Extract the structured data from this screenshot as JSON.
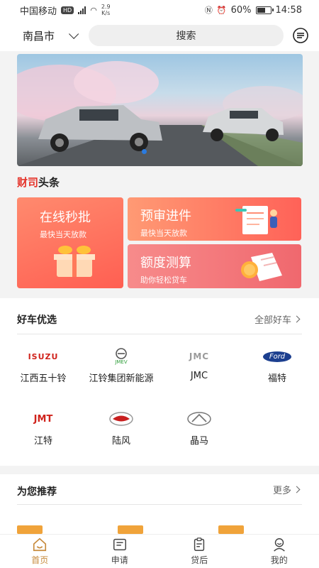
{
  "status_bar": {
    "carrier": "中国移动",
    "hd": "HD",
    "network": "4G",
    "speed_value": "2.9",
    "speed_unit": "K/s",
    "battery": "60%",
    "time": "14:58"
  },
  "header": {
    "city": "南昌市",
    "search_label": "搜索"
  },
  "headline": {
    "red_part": "财司",
    "rest": "头条"
  },
  "promos": {
    "big": {
      "title": "在线秒批",
      "subtitle": "最快当天放款"
    },
    "a": {
      "title": "预审进件",
      "subtitle": "最快当天放款"
    },
    "b": {
      "title": "额度测算",
      "subtitle": "助你轻松贷车"
    }
  },
  "cars": {
    "title": "好车优选",
    "link": "全部好车",
    "brands": [
      {
        "label": "江西五十铃",
        "logo_text": "ISUZU",
        "logo_color": "#d0231c",
        "icon": "isuzu-logo"
      },
      {
        "label": "江铃集团新能源",
        "logo_text": "JMEV",
        "logo_color": "#2f9e3a",
        "icon": "jmev-logo"
      },
      {
        "label": "JMC",
        "logo_text": "JMC",
        "logo_color": "#9a9a9a",
        "icon": "jmc-logo"
      },
      {
        "label": "福特",
        "logo_text": "Ford",
        "logo_color": "#1c3f8f",
        "icon": "ford-logo"
      },
      {
        "label": "江特",
        "logo_text": "JMT",
        "logo_color": "#d0231c",
        "icon": "jmt-logo"
      },
      {
        "label": "陆风",
        "logo_text": "",
        "logo_color": "#c81f1f",
        "icon": "landwind-logo"
      },
      {
        "label": "晶马",
        "logo_text": "",
        "logo_color": "#777777",
        "icon": "jingma-logo"
      }
    ]
  },
  "recommend": {
    "title": "为您推荐",
    "link": "更多"
  },
  "nav": [
    {
      "label": "首页",
      "icon": "home-icon",
      "active": true
    },
    {
      "label": "申请",
      "icon": "apply-icon",
      "active": false
    },
    {
      "label": "贷后",
      "icon": "clipboard-icon",
      "active": false
    },
    {
      "label": "我的",
      "icon": "profile-icon",
      "active": false
    }
  ],
  "colors": {
    "accent": "#c78a3b",
    "promo_red": "#ff6258",
    "link_blue": "#2a7be0"
  }
}
